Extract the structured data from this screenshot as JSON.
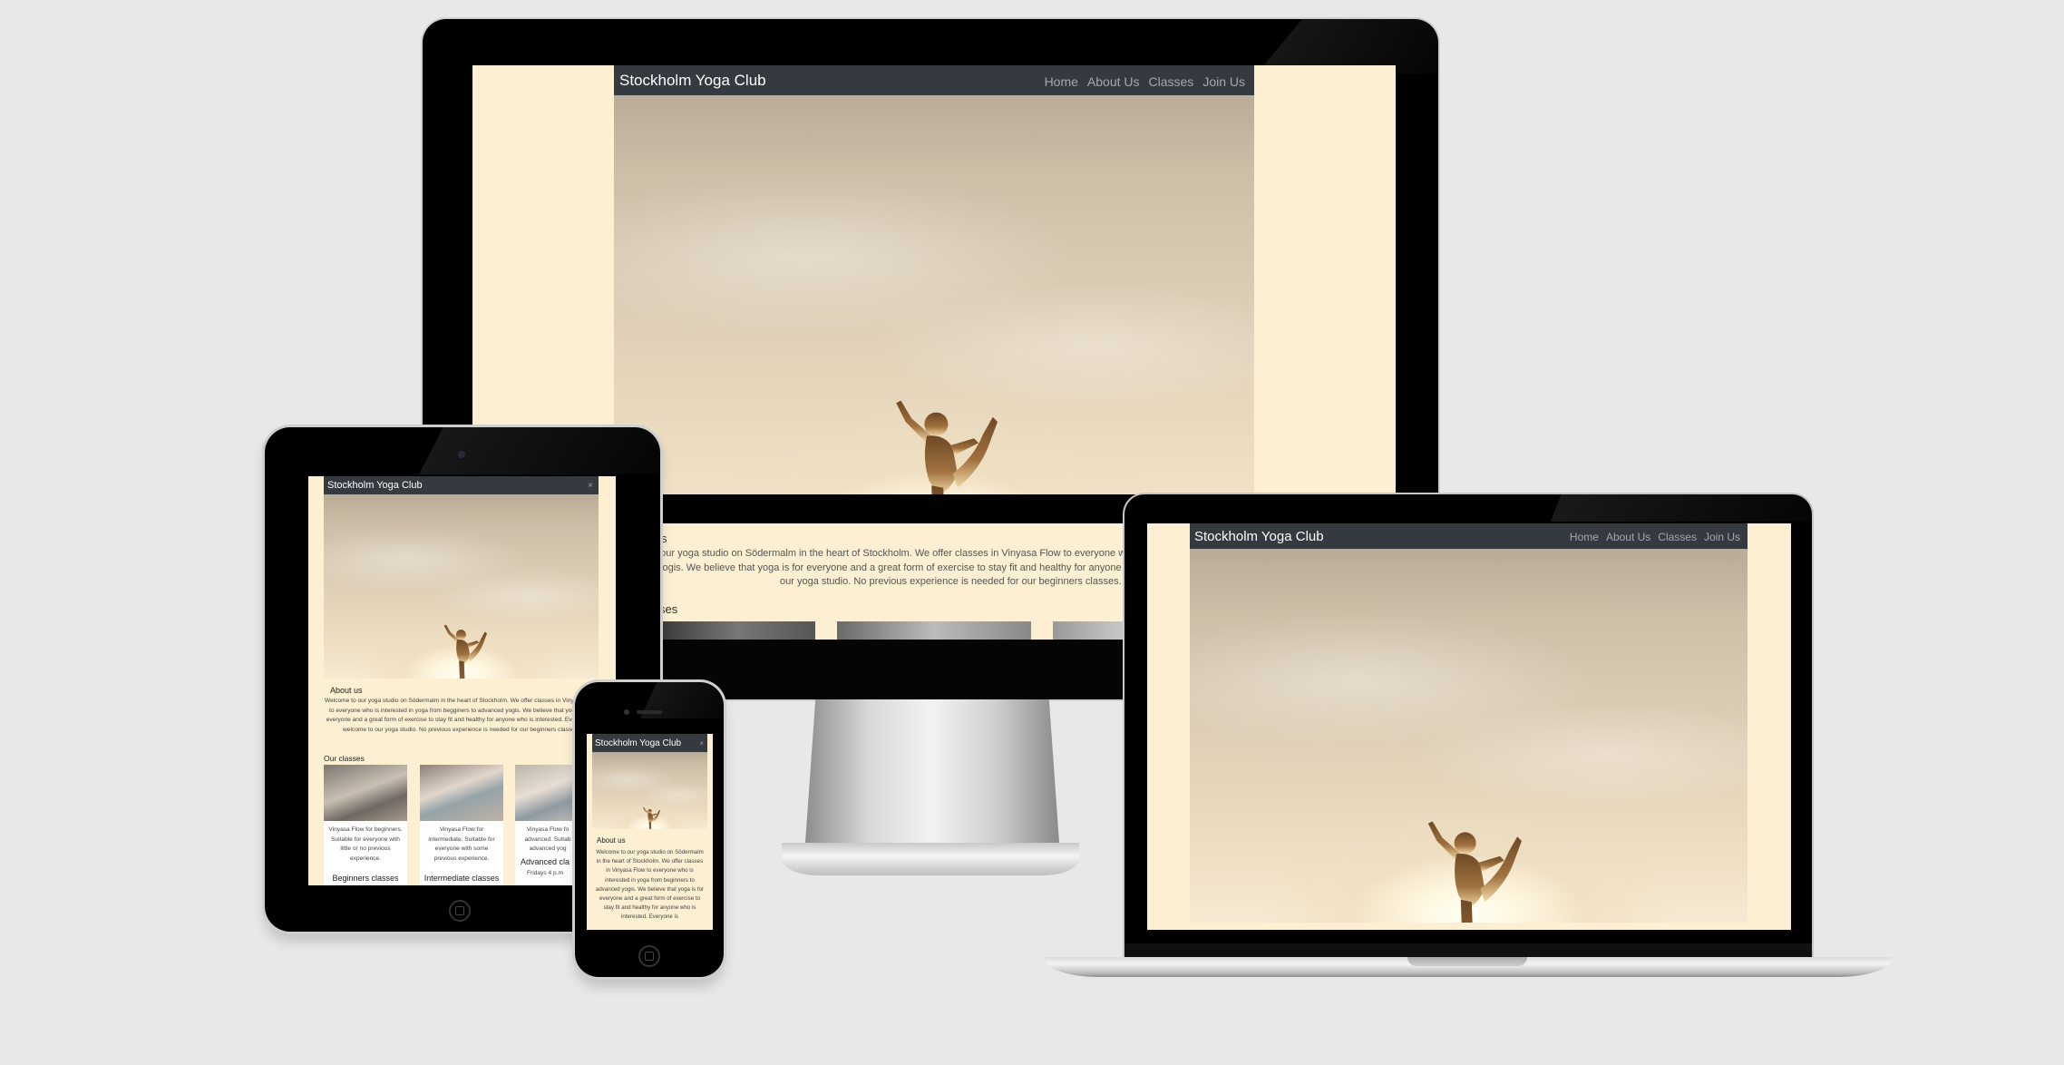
{
  "site": {
    "brand": "Stockholm Yoga Club",
    "nav": [
      "Home",
      "About Us",
      "Classes",
      "Join Us"
    ],
    "close_glyph": "×",
    "about_heading": "About us",
    "about_heading_fragment": "s",
    "about_text_full": "Welcome to our yoga studio on Södermalm in the heart of Stockholm. We offer classes in Vinyasa Flow to everyone who is interested in yoga from begginers to advanced yogis. We believe that yoga is for everyone and a great form of exercise to stay fit and healthy for anyone who is interested. Everyone is welcome to our yoga studio. No previous experience is needed for our beginners classes.",
    "desktop_about_line1": "o our yoga studio on Södermalm in the heart of Stockholm. We offer classes in Vinyasa Flow to everyone who is inte",
    "desktop_about_line2": "yogis. We believe that yoga is for everyone and a great form of exercise to stay fit and healthy for anyone who is int",
    "desktop_about_line3": "our yoga studio. No previous experience is needed for our beginners classes.",
    "desktop_classes_fragment": "ses",
    "classes_heading": "Our classes",
    "classes": [
      {
        "desc": "Vinyasa Flow for beginners. Suitable for everyone with little or no previous experience.",
        "title": "Beginners classes"
      },
      {
        "desc": "Vinyasa Flow for intermediate. Suitable for everyone with some previous experience.",
        "title": "Intermediate classes"
      },
      {
        "desc": "Vinyasa Flow for advanced. Suitable for advanced yogis.",
        "title": "Advanced classes",
        "extra": "Fridays 4 p.m."
      }
    ],
    "tablet_class3_desc_visible": "Vinyasa Flow fo advanced. Suitab advanced yog",
    "tablet_class3_title_visible": "Advanced cla",
    "tablet_class3_extra_visible": "Fridays 4 p.m",
    "phone_about_text": "Welcome to our yoga studio on Södermalm in the heart of Stockholm. We offer classes in Vinyasa Flow to everyone who is interested in yoga from beginners to advanced yogis. We believe that yoga is for everyone and a great form of exercise to stay fit and healthy for anyone who is interested. Everyone is"
  },
  "colors": {
    "background": "#e8e8e8",
    "nav": "#343a40",
    "cream": "#fcefd2",
    "device": "#000000"
  }
}
